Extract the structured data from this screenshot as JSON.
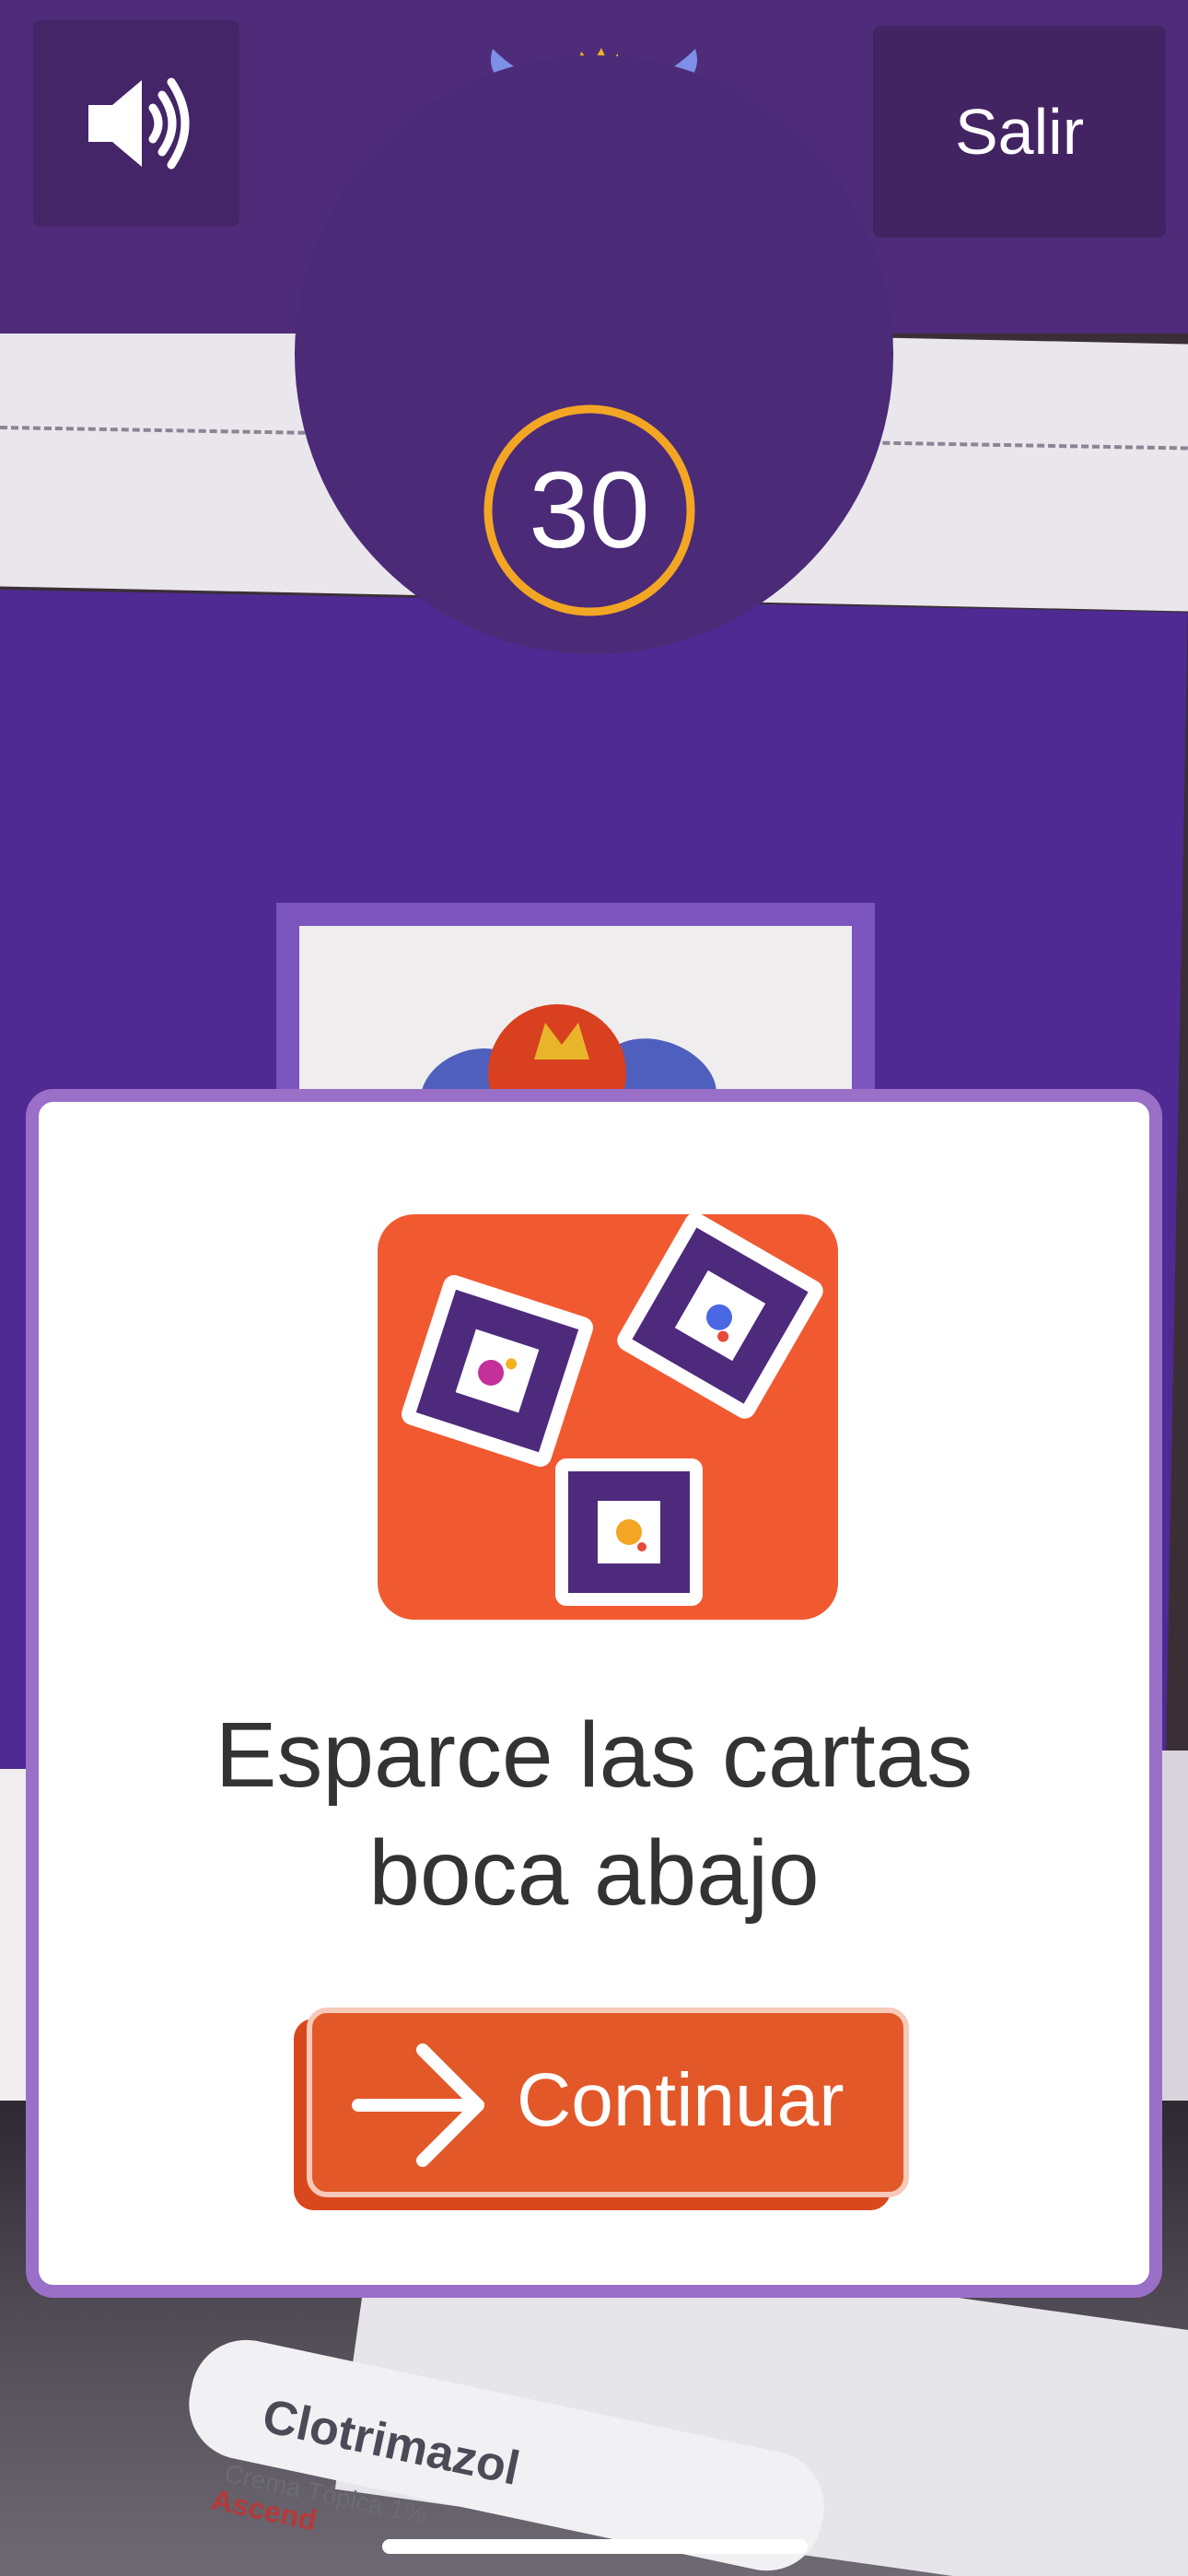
{
  "header": {
    "sound_icon": "speaker-sound-icon",
    "exit_label": "Salir",
    "mascot_icon": "blue-monster-mascot-icon"
  },
  "timer": {
    "value": "30"
  },
  "dialog": {
    "illustration_icon": "scattered-cards-illustration",
    "instruction_line1": "Esparce las cartas",
    "instruction_line2": "boca abajo",
    "continue_label": "Continuar",
    "continue_icon": "arrow-right-icon"
  },
  "background": {
    "tube_text": "Clotrimazol",
    "tube_subtext": "Crema Tópica 1%",
    "tube_brand": "Ascend"
  },
  "colors": {
    "header_bg": "#4f2c7a",
    "timer_ring": "#f2a623",
    "dialog_border": "#9a6fc8",
    "accent_orange": "#e25828"
  }
}
